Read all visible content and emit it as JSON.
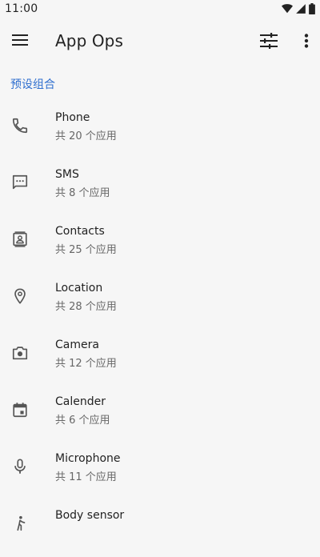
{
  "status_bar": {
    "time": "11:00",
    "icons": [
      "wifi-icon",
      "signal-icon",
      "battery-icon"
    ]
  },
  "app_bar": {
    "title": "App Ops",
    "left_icon": "menu-icon",
    "right_icons": [
      "filter-icon",
      "more-vert-icon"
    ]
  },
  "section": {
    "title": "预设组合"
  },
  "items": [
    {
      "title": "Phone",
      "subtitle": "共 20 个应用",
      "icon": "phone-icon"
    },
    {
      "title": "SMS",
      "subtitle": "共 8 个应用",
      "icon": "sms-icon"
    },
    {
      "title": "Contacts",
      "subtitle": "共 25 个应用",
      "icon": "contacts-icon"
    },
    {
      "title": "Location",
      "subtitle": "共 28 个应用",
      "icon": "location-icon"
    },
    {
      "title": "Camera",
      "subtitle": "共 12 个应用",
      "icon": "camera-icon"
    },
    {
      "title": "Calender",
      "subtitle": "共 6 个应用",
      "icon": "calendar-icon"
    },
    {
      "title": "Microphone",
      "subtitle": "共 11 个应用",
      "icon": "microphone-icon"
    },
    {
      "title": "Body sensor",
      "subtitle": "",
      "icon": "body-sensor-icon"
    }
  ],
  "colors": {
    "background": "#f6f6f6",
    "accent": "#2f6fcf",
    "icon": "#555555",
    "title": "#222222",
    "subtitle": "#666666"
  }
}
